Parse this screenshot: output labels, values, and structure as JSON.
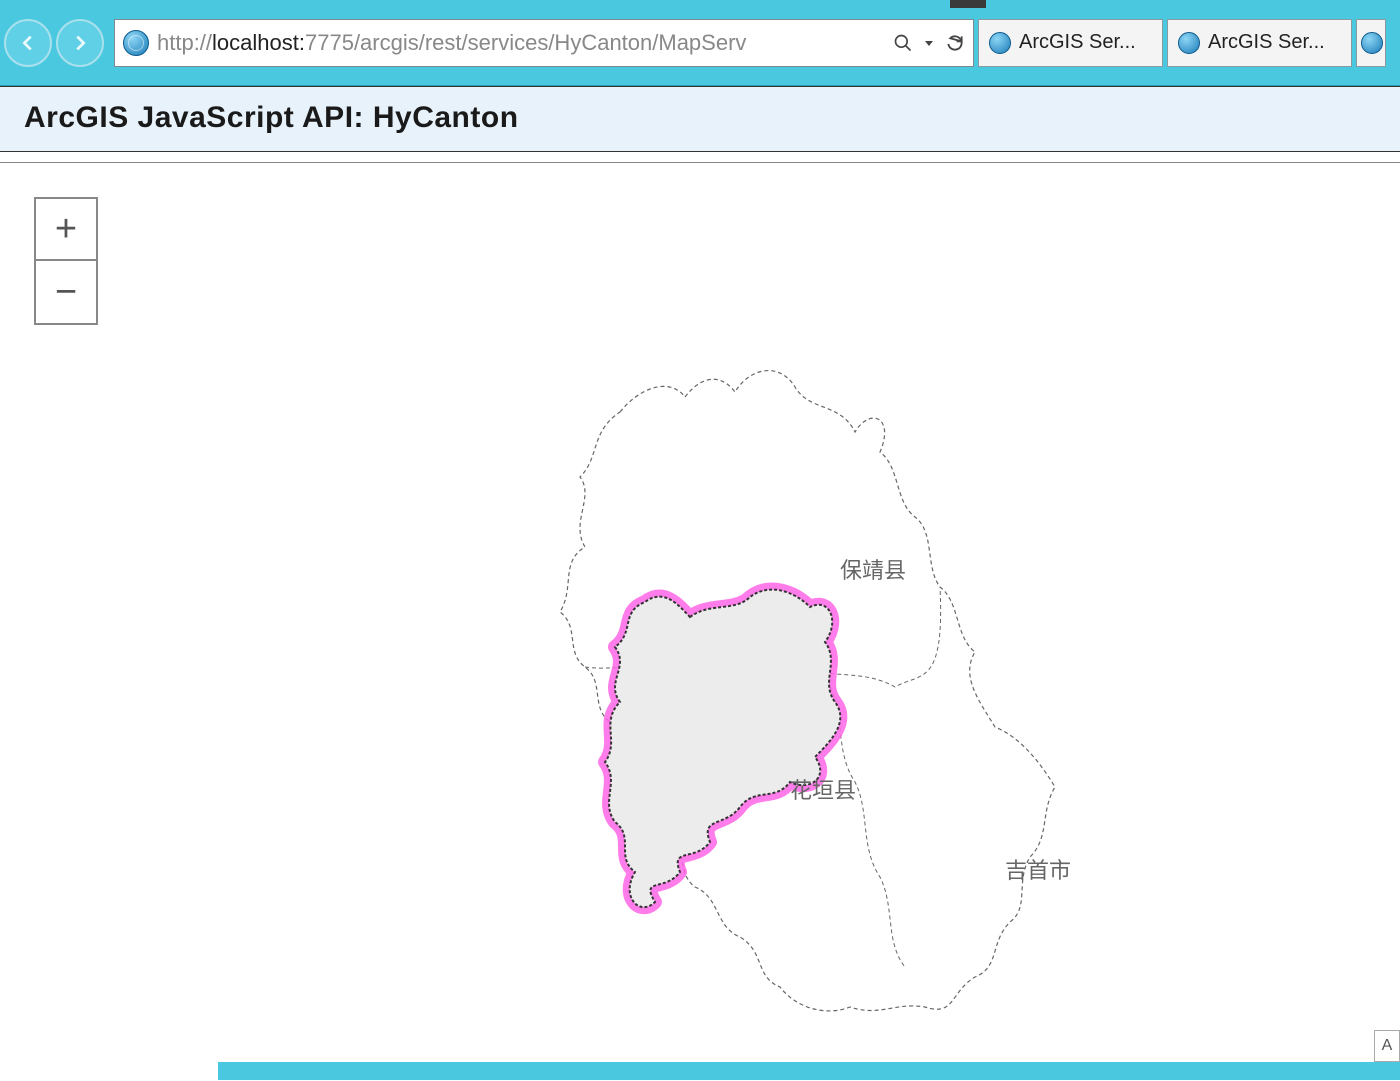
{
  "browser": {
    "url_prefix": "http://",
    "url_host": "localhost:",
    "url_rest": "7775/arcgis/rest/services/HyCanton/MapServ",
    "tabs": [
      {
        "label": "ArcGIS Ser..."
      },
      {
        "label": "ArcGIS Ser..."
      }
    ]
  },
  "header": {
    "title": "ArcGIS JavaScript API: HyCanton"
  },
  "zoom": {
    "in": "+",
    "out": "−"
  },
  "map": {
    "labels": {
      "baojing": "保靖县",
      "huayuan": "花垣县",
      "jishou": "吉首市"
    },
    "highlight_color": "#ff66e6",
    "highlight_fill": "#ececec",
    "boundary_color": "#555555"
  },
  "attribution_char": "A"
}
